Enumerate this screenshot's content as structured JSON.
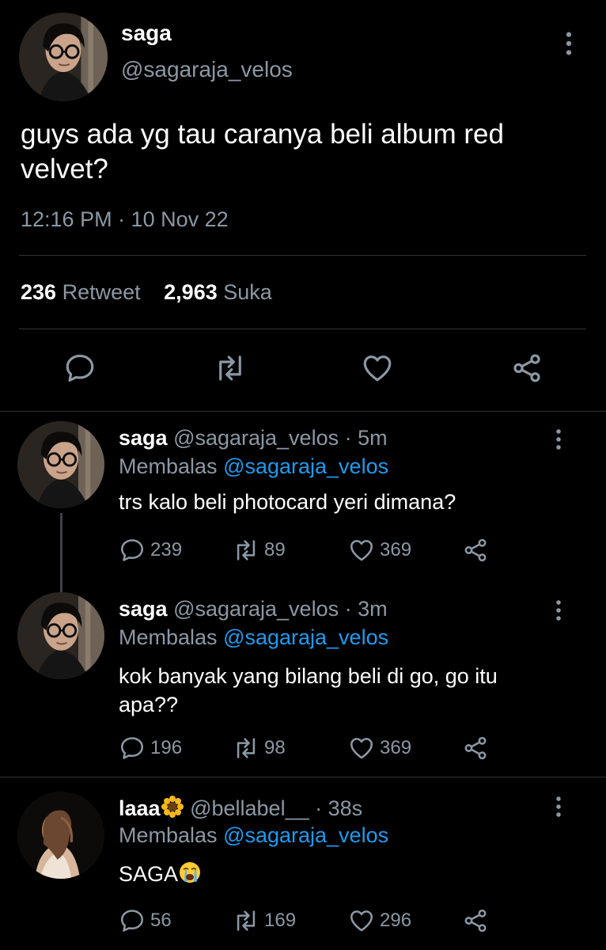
{
  "main_tweet": {
    "author_name": "saga",
    "author_handle": "@sagaraja_velos",
    "text": "guys ada yg tau caranya beli album red velvet?",
    "timestamp": "12:16 PM · 10 Nov 22",
    "retweet_count": "236",
    "retweet_label": "Retweet",
    "like_count": "2,963",
    "like_label": "Suka",
    "icons": [
      "reply-icon",
      "retweet-icon",
      "like-icon",
      "share-icon"
    ]
  },
  "replies": [
    {
      "author_name": "saga",
      "author_handle": "@sagaraja_velos",
      "time": "· 5m",
      "replying_label": "Membalas",
      "replying_to": "@sagaraja_velos",
      "text": "trs kalo beli photocard yeri dimana?",
      "reply_count": "239",
      "retweet_count": "89",
      "like_count": "369"
    },
    {
      "author_name": "saga",
      "author_handle": "@sagaraja_velos",
      "time": "· 3m",
      "replying_label": "Membalas",
      "replying_to": "@sagaraja_velos",
      "text": "kok banyak yang bilang beli di go, go itu apa??",
      "reply_count": "196",
      "retweet_count": "98",
      "like_count": "369"
    },
    {
      "author_name": "laaa",
      "author_handle": "@bellabel__",
      "time": "· 38s",
      "replying_label": "Membalas",
      "replying_to": "@sagaraja_velos",
      "text": "SAGA",
      "reply_count": "56",
      "retweet_count": "169",
      "like_count": "296"
    }
  ],
  "colors": {
    "background": "#000000",
    "primary_text": "#e7e9ea",
    "secondary_text": "#8b98a5",
    "link": "#1d9bf0",
    "divider": "#2f3336"
  }
}
